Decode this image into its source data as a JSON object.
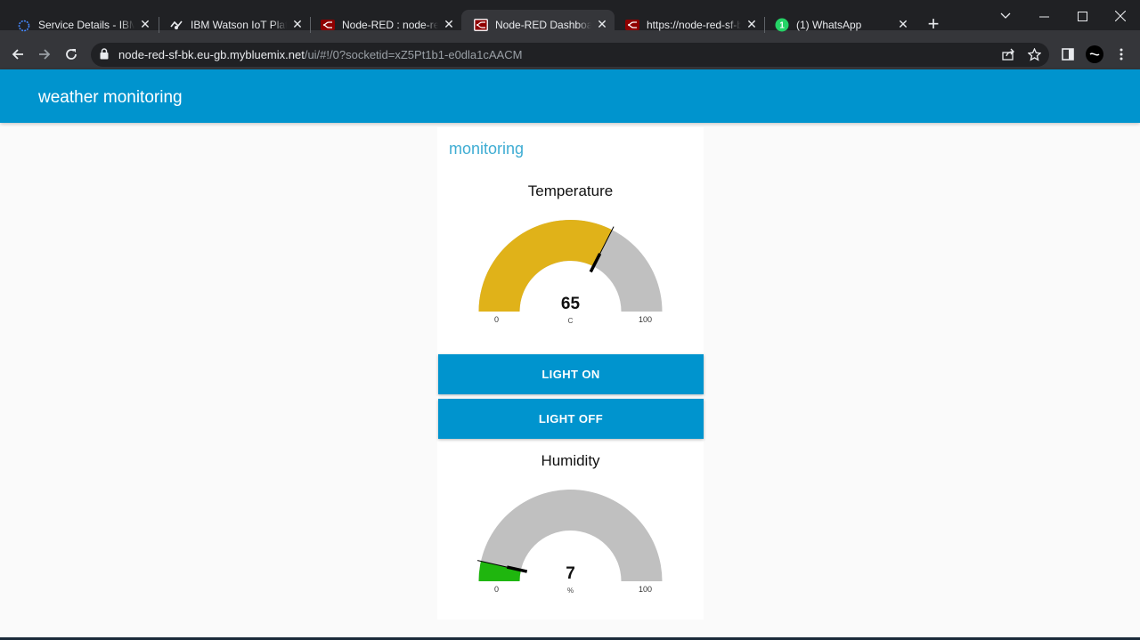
{
  "browser": {
    "tabs": [
      {
        "title": "Service Details - IBM Cloud",
        "icon": "ibm-cloud-icon"
      },
      {
        "title": "IBM Watson IoT Platform",
        "icon": "watson-iot-icon"
      },
      {
        "title": "Node-RED : node-red-sf-bk",
        "icon": "node-red-icon"
      },
      {
        "title": "Node-RED Dashboard",
        "icon": "node-red-dashboard-icon"
      },
      {
        "title": "https://node-red-sf-bk.eu-gb",
        "icon": "node-red-icon"
      },
      {
        "title": "(1) WhatsApp",
        "icon": "whatsapp-icon"
      }
    ],
    "active_tab": 3,
    "whatsapp_badge": "1",
    "new_tab_label": "+",
    "url_host": "node-red-sf-bk.eu-gb.mybluemix.net",
    "url_path": "/ui/#!/0?socketid=xZ5Pt1b1-e0dla1cAACM"
  },
  "dashboard": {
    "title": "weather monitoring",
    "group_title": "monitoring",
    "temperature": {
      "title": "Temperature",
      "value": "65",
      "units": "C",
      "min": "0",
      "max": "100",
      "level": 0.65,
      "color": "#e0b219"
    },
    "buttons": {
      "light_on": "LIGHT ON",
      "light_off": "LIGHT OFF"
    },
    "humidity": {
      "title": "Humidity",
      "value": "7",
      "units": "%",
      "min": "0",
      "max": "100",
      "level": 0.07,
      "color": "#1fb60e"
    }
  },
  "colors": {
    "header": "#0094ce",
    "group_title": "#3fadd3",
    "gauge_bg": "#c0c0c0"
  }
}
